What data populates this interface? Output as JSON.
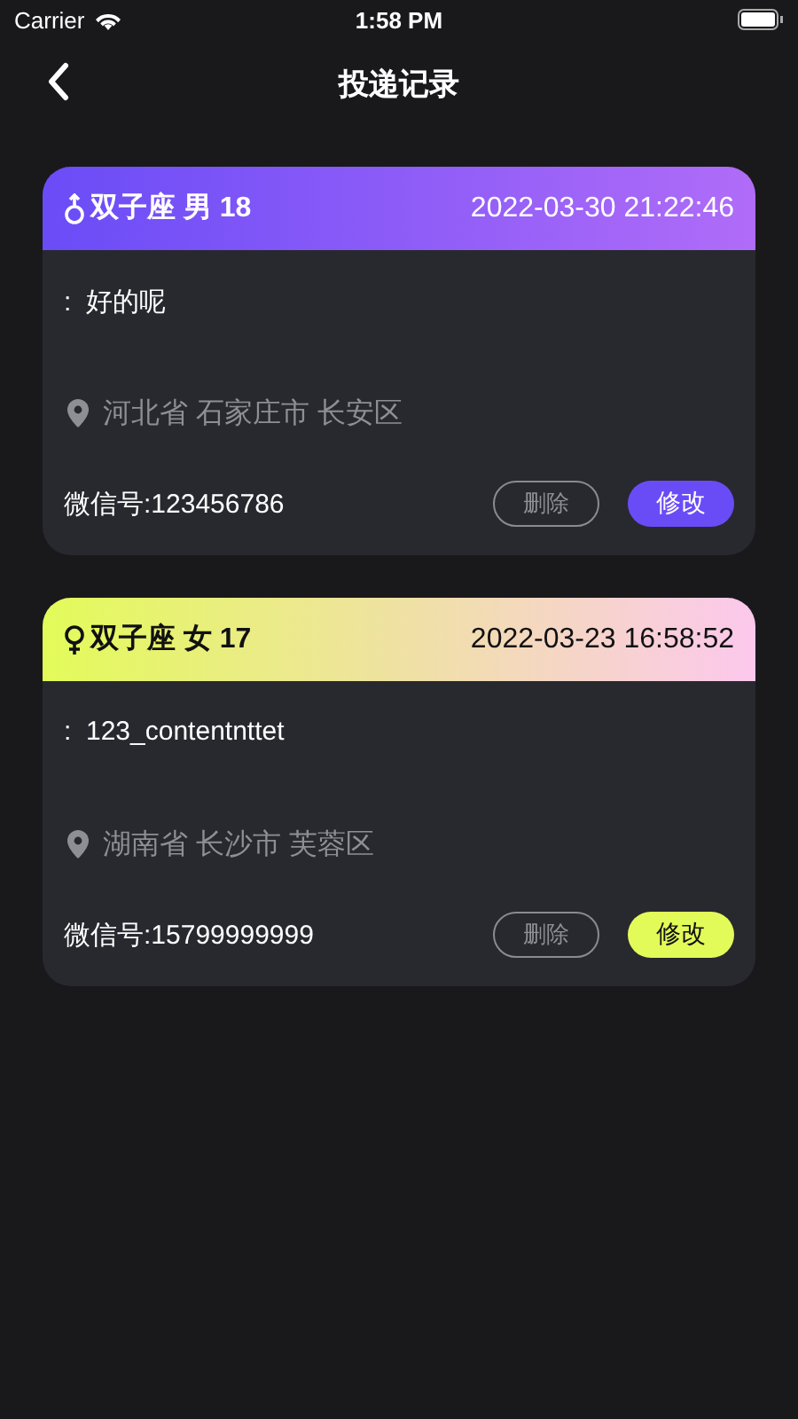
{
  "status_bar": {
    "carrier": "Carrier",
    "time": "1:58 PM"
  },
  "nav": {
    "title": "投递记录"
  },
  "records": [
    {
      "kind": "male",
      "title": "双子座 男 18",
      "time": "2022-03-30 21:22:46",
      "content": ":  好的呢",
      "location": "河北省 石家庄市 长安区",
      "wechat": "微信号:123456786",
      "delete_label": "删除",
      "edit_label": "修改"
    },
    {
      "kind": "female",
      "title": "双子座 女 17",
      "time": "2022-03-23 16:58:52",
      "content": ":  123_contentnttet",
      "location": "湖南省 长沙市 芙蓉区",
      "wechat": "微信号:15799999999",
      "delete_label": "删除",
      "edit_label": "修改"
    }
  ]
}
